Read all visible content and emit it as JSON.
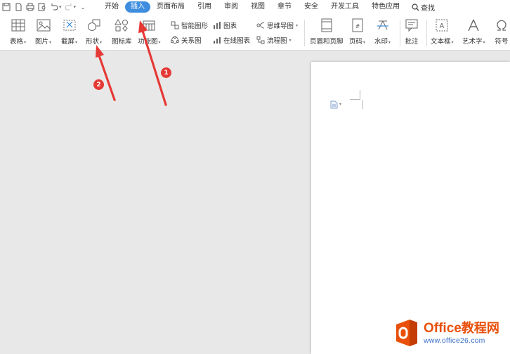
{
  "menubar": {
    "tabs": [
      "开始",
      "插入",
      "页面布局",
      "引用",
      "审阅",
      "视图",
      "章节",
      "安全",
      "开发工具",
      "特色应用"
    ],
    "active_tab": "插入",
    "search_label": "查找"
  },
  "ribbon": {
    "table": "表格",
    "picture": "图片",
    "screenshot": "截屏",
    "shape": "形状",
    "icon_lib": "图标库",
    "function_chart": "功能图",
    "smart_graphic": "智能图形",
    "chart": "图表",
    "mind_map": "思维导图",
    "relation_chart": "关系图",
    "online_chart": "在线图表",
    "flowchart": "流程图",
    "header_footer": "页眉和页脚",
    "page_number": "页码",
    "watermark": "水印",
    "comment": "批注",
    "text_box": "文本框",
    "art_text": "艺术字",
    "symbol": "符号"
  },
  "annotations": [
    "1",
    "2"
  ],
  "watermark": {
    "brand_latin": "Office",
    "brand_cn": "教程网",
    "url": "www.office26.com"
  },
  "colors": {
    "accent": "#3f8ddf",
    "annotation": "#e53935",
    "brand_orange": "#e8500b",
    "brand_blue": "#3a6fc6"
  }
}
